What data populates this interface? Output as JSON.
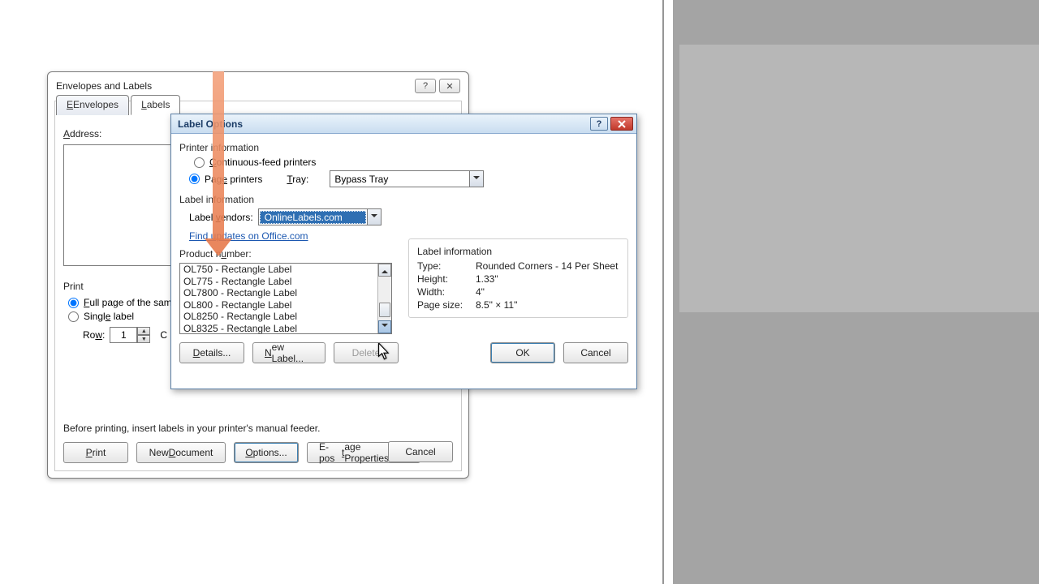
{
  "dlg1": {
    "title": "Envelopes and Labels",
    "tabs": {
      "envelopes": "Envelopes",
      "labels": "Labels"
    },
    "address_label": "Address:",
    "print": {
      "group": "Print",
      "full": "Full page of the sam",
      "single": "Single label",
      "row_label": "Row:",
      "row_value": "1",
      "col_letter": "C"
    },
    "note": "Before printing, insert labels in your printer's manual feeder.",
    "buttons": {
      "print": "Print",
      "newdoc": "New Document",
      "options": "Options...",
      "epostage": "E-postage Properties...",
      "cancel": "Cancel"
    }
  },
  "dlg2": {
    "title": "Label Options",
    "printer_info": "Printer information",
    "continuous": "Continuous-feed printers",
    "page_printers": "Page printers",
    "tray_label": "Tray:",
    "tray_value": "Bypass Tray",
    "label_info_h": "Label information",
    "vendor_label": "Label vendors:",
    "vendor_value": "OnlineLabels.com",
    "update_link": "Find updates on Office.com",
    "product_label": "Product number:",
    "products": [
      "OL750 - Rectangle Label",
      "OL775 - Rectangle Label",
      "OL7800 - Rectangle Label",
      "OL800 - Rectangle Label",
      "OL8250 - Rectangle Label",
      "OL8325 - Rectangle Label"
    ],
    "info": {
      "title": "Label information",
      "type_k": "Type:",
      "type_v": "Rounded Corners - 14 Per Sheet",
      "height_k": "Height:",
      "height_v": "1.33\"",
      "width_k": "Width:",
      "width_v": "4\"",
      "page_k": "Page size:",
      "page_v": "8.5\" × 11\""
    },
    "buttons": {
      "details": "Details...",
      "newlabel": "New Label...",
      "delete": "Delete",
      "ok": "OK",
      "cancel": "Cancel"
    }
  }
}
